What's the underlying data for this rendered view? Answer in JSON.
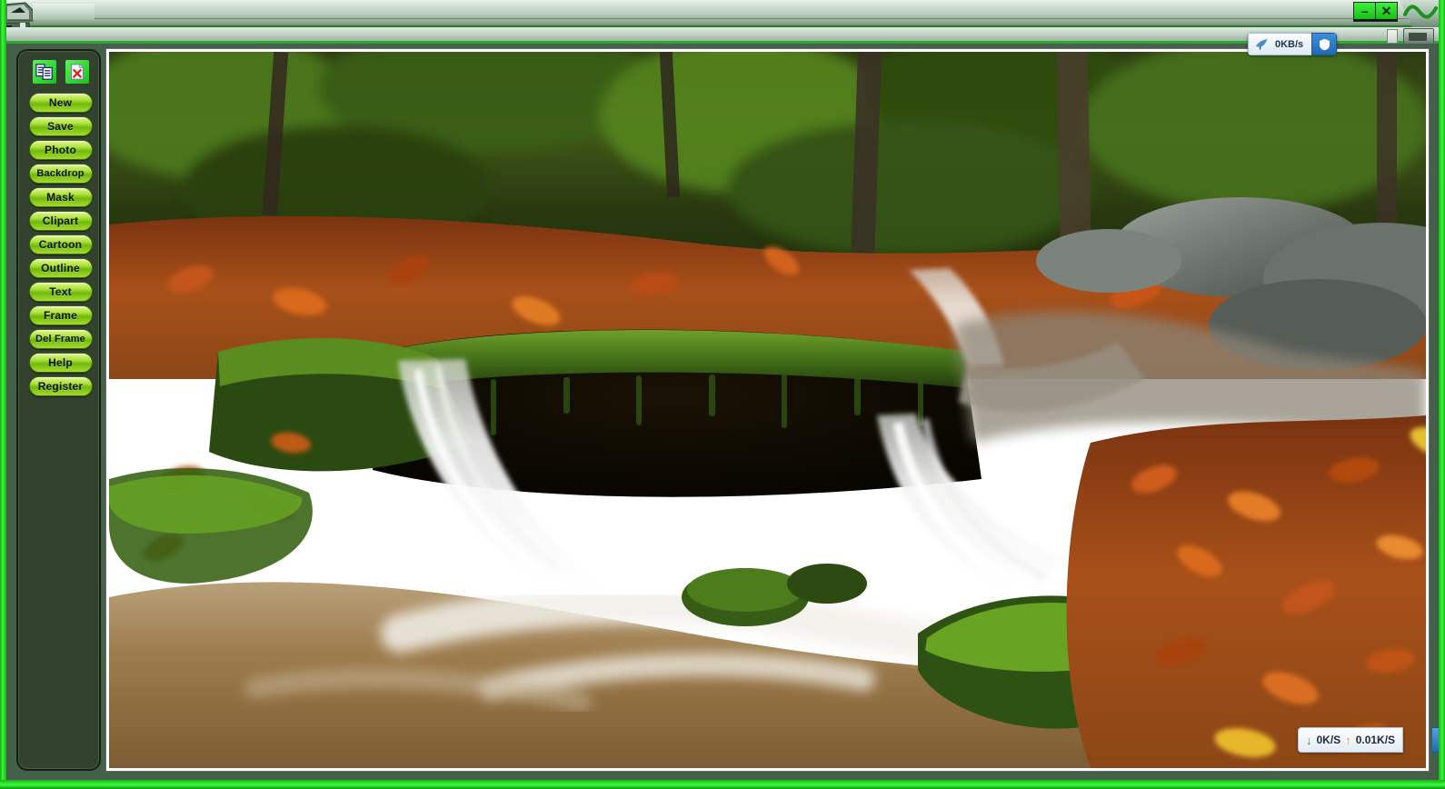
{
  "window": {
    "title": "",
    "controls": [
      {
        "name": "minimize",
        "glyph": "–"
      },
      {
        "name": "close",
        "glyph": "✕"
      }
    ],
    "accent_green": "#2ce82c",
    "titlebar_gradient_top": "#e9f2ec",
    "titlebar_gradient_bottom": "#728c78"
  },
  "sidebar": {
    "background": "#33422f",
    "tool_icons": [
      {
        "label": "duplicate",
        "icon": "copy-pages-icon"
      },
      {
        "label": "delete",
        "icon": "document-delete-icon"
      }
    ],
    "buttons": [
      {
        "label": "New"
      },
      {
        "label": "Save"
      },
      {
        "label": "Photo"
      },
      {
        "label": "Backdrop"
      },
      {
        "label": "Mask"
      },
      {
        "label": "Clipart"
      },
      {
        "label": "Cartoon"
      },
      {
        "label": "Outline"
      },
      {
        "label": "Text"
      },
      {
        "label": "Frame"
      },
      {
        "label": "Del Frame"
      },
      {
        "label": "Help"
      },
      {
        "label": "Register"
      }
    ]
  },
  "canvas": {
    "photo_description": "Autumn forest waterfall cascading over mossy rocks with orange fallen leaves",
    "border_color": "#ffffff"
  },
  "net_widget_top": {
    "icon": "hummingbird-icon",
    "speed": "0KB/s",
    "shield_icon": "shield-icon",
    "accent": "#1f6ab4"
  },
  "net_widget_bottom": {
    "down_arrow": "↓",
    "down_speed": "0K/S",
    "up_arrow": "↑",
    "up_speed": "0.01K/S"
  }
}
